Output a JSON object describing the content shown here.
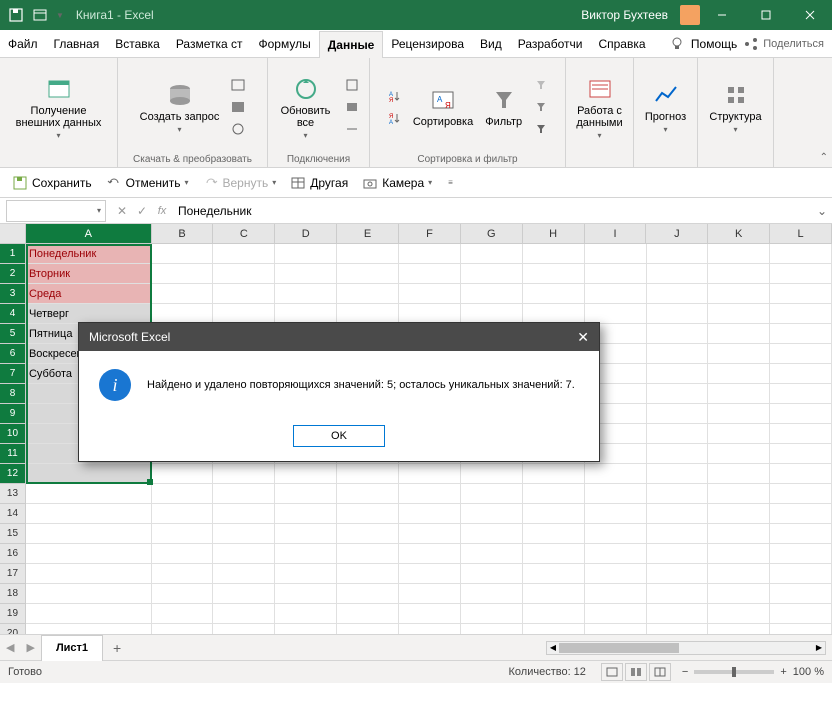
{
  "titlebar": {
    "title": "Книга1 - Excel",
    "user": "Виктор Бухтеев"
  },
  "menubar": {
    "items": [
      "Файл",
      "Главная",
      "Вставка",
      "Разметка ст",
      "Формулы",
      "Данные",
      "Рецензирова",
      "Вид",
      "Разработчи",
      "Справка"
    ],
    "active_index": 5,
    "help": "Помощь",
    "share": "Поделиться"
  },
  "ribbon": {
    "g0": {
      "btn": "Получение внешних данных"
    },
    "g1": {
      "btn": "Создать запрос",
      "label": "Скачать & преобразовать"
    },
    "g2": {
      "btn": "Обновить все",
      "label": "Подключения"
    },
    "g3": {
      "sort": "Сортировка",
      "filter": "Фильтр",
      "label": "Сортировка и фильтр"
    },
    "g4": {
      "btn": "Работа с данными"
    },
    "g5": {
      "btn": "Прогноз"
    },
    "g6": {
      "btn": "Структура"
    }
  },
  "qat": {
    "save": "Сохранить",
    "undo": "Отменить",
    "redo": "Вернуть",
    "other": "Другая",
    "camera": "Камера"
  },
  "formula": {
    "namebox": "",
    "value": "Понедельник"
  },
  "columns": [
    "A",
    "B",
    "C",
    "D",
    "E",
    "F",
    "G",
    "H",
    "I",
    "J",
    "K",
    "L"
  ],
  "cells": {
    "a": [
      "Понедельник",
      "Вторник",
      "Среда",
      "Четверг",
      "Пятница",
      "Воскресенье",
      "Суббота"
    ]
  },
  "sheet_tab": "Лист1",
  "status": {
    "ready": "Готово",
    "count": "Количество: 12",
    "zoom": "100 %"
  },
  "dialog": {
    "title": "Microsoft Excel",
    "message": "Найдено и удалено повторяющихся значений: 5; осталось уникальных значений: 7.",
    "ok": "OK"
  }
}
